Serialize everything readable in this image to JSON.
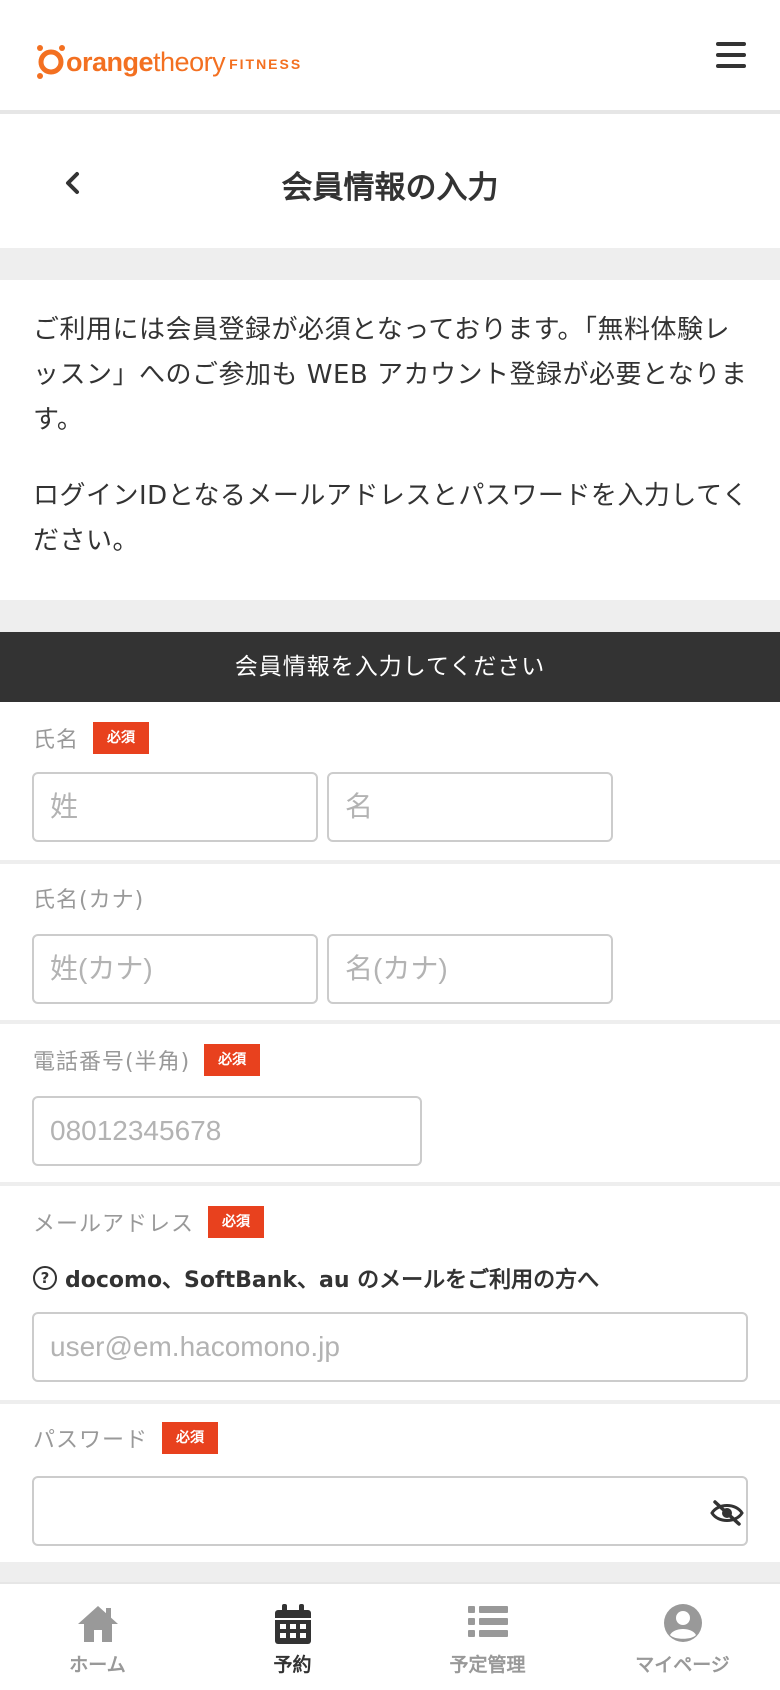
{
  "header": {
    "logo_main": "orange",
    "logo_theory": "theory",
    "logo_fitness": "FITNESS"
  },
  "titlebar": {
    "title": "会員情報の入力"
  },
  "intro": {
    "p1": "ご利用には会員登録が必須となっております。「無料体験レッスン」へのご参加も WEB アカウント登録が必要となります。",
    "p2": "ログインIDとなるメールアドレスとパスワードを入力してください。"
  },
  "form": {
    "section_title": "会員情報を入力してください",
    "required_badge": "必須",
    "name": {
      "label": "氏名",
      "last_placeholder": "姓",
      "first_placeholder": "名"
    },
    "name_kana": {
      "label": "氏名(カナ)",
      "last_placeholder": "姓(カナ)",
      "first_placeholder": "名(カナ)"
    },
    "phone": {
      "label": "電話番号(半角)",
      "placeholder": "08012345678"
    },
    "email": {
      "label": "メールアドレス",
      "note": "docomo、SoftBank、au のメールをご利用の方へ",
      "note_icon": "question-circle-icon",
      "placeholder": "user@em.hacomono.jp"
    },
    "password": {
      "label": "パスワード",
      "value": "",
      "toggle_icon": "eye-slash-icon"
    }
  },
  "tabbar": {
    "tabs": [
      {
        "label": "ホーム",
        "icon": "home-icon"
      },
      {
        "label": "予約",
        "icon": "calendar-icon",
        "active": true
      },
      {
        "label": "予定管理",
        "icon": "list-icon"
      },
      {
        "label": "マイページ",
        "icon": "user-circle-icon"
      }
    ]
  },
  "colors": {
    "brand_orange": "#f37021",
    "badge_red": "#e8411e",
    "section_dark": "#333333"
  }
}
